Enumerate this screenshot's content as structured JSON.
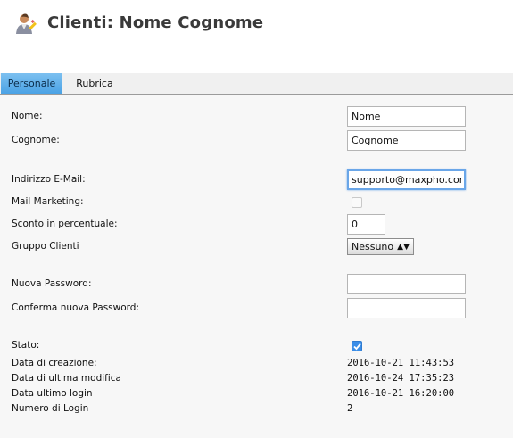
{
  "header": {
    "title": "Clienti: Nome Cognome",
    "icon": "user-edit-icon"
  },
  "tabs": [
    {
      "label": "Personale",
      "active": true
    },
    {
      "label": "Rubrica",
      "active": false
    }
  ],
  "form": {
    "nome_label": "Nome:",
    "nome_value": "Nome",
    "cognome_label": "Cognome:",
    "cognome_value": "Cognome",
    "email_label": "Indirizzo E-Mail:",
    "email_value": "supporto@maxpho.cor",
    "mail_marketing_label": "Mail Marketing:",
    "mail_marketing_checked": false,
    "sconto_label": "Sconto in percentuale:",
    "sconto_value": "0",
    "gruppo_label": "Gruppo Clienti",
    "gruppo_selected": "Nessuno",
    "password_label": "Nuova Password:",
    "password_value": "",
    "confirm_password_label": "Conferma nuova Password:",
    "confirm_password_value": "",
    "stato_label": "Stato:",
    "stato_checked": true,
    "data_creazione_label": "Data di creazione:",
    "data_creazione_value": "2016-10-21 11:43:53",
    "data_modifica_label": "Data di ultima modifica",
    "data_modifica_value": "2016-10-24 17:35:23",
    "ultimo_login_label": "Data ultimo login",
    "ultimo_login_value": "2016-10-21 16:20:00",
    "numero_login_label": "Numero di Login",
    "numero_login_value": "2"
  }
}
